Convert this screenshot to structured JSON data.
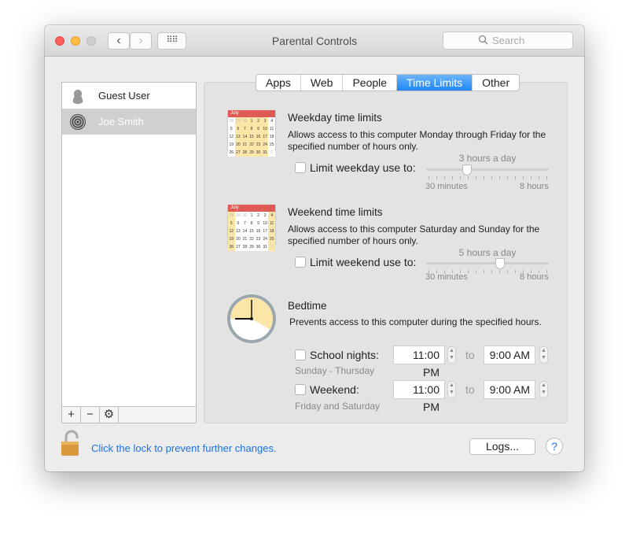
{
  "window": {
    "title": "Parental Controls",
    "search_placeholder": "Search"
  },
  "users": [
    {
      "name": "Guest User",
      "selected": false
    },
    {
      "name": "Joe Smith",
      "selected": true
    }
  ],
  "list_controls": {
    "add": "+",
    "remove": "−",
    "settings_icon": "gear-icon"
  },
  "tabs": [
    {
      "label": "Apps"
    },
    {
      "label": "Web"
    },
    {
      "label": "People"
    },
    {
      "label": "Time Limits",
      "active": true
    },
    {
      "label": "Other"
    }
  ],
  "weekday": {
    "title": "Weekday time limits",
    "description": "Allows access to this computer Monday through Friday for the specified number of hours only.",
    "checkbox_label": "Limit weekday use to:",
    "checked": false,
    "value_label": "3 hours a day",
    "value_hours": 3,
    "min_label": "30 minutes",
    "max_label": "8 hours",
    "calendar_month": "July"
  },
  "weekend": {
    "title": "Weekend time limits",
    "description": "Allows access to this computer Saturday and Sunday for the specified number of hours only.",
    "checkbox_label": "Limit weekend use to:",
    "checked": false,
    "value_label": "5 hours a day",
    "value_hours": 5,
    "min_label": "30 minutes",
    "max_label": "8 hours",
    "calendar_month": "July"
  },
  "bedtime": {
    "title": "Bedtime",
    "description": "Prevents access to this computer during the specified hours.",
    "to_label": "to",
    "school": {
      "label": "School nights:",
      "sub": "Sunday - Thursday",
      "from": "11:00 PM",
      "to": "9:00 AM",
      "checked": false
    },
    "weekend": {
      "label": "Weekend:",
      "sub": "Friday and Saturday",
      "from": "11:00 PM",
      "to": "9:00 AM",
      "checked": false
    }
  },
  "footer": {
    "lock_text": "Click the lock to prevent further changes.",
    "logs_button": "Logs...",
    "help_button": "?"
  },
  "colors": {
    "accent": "#1e88f7",
    "link": "#1a73e8"
  }
}
